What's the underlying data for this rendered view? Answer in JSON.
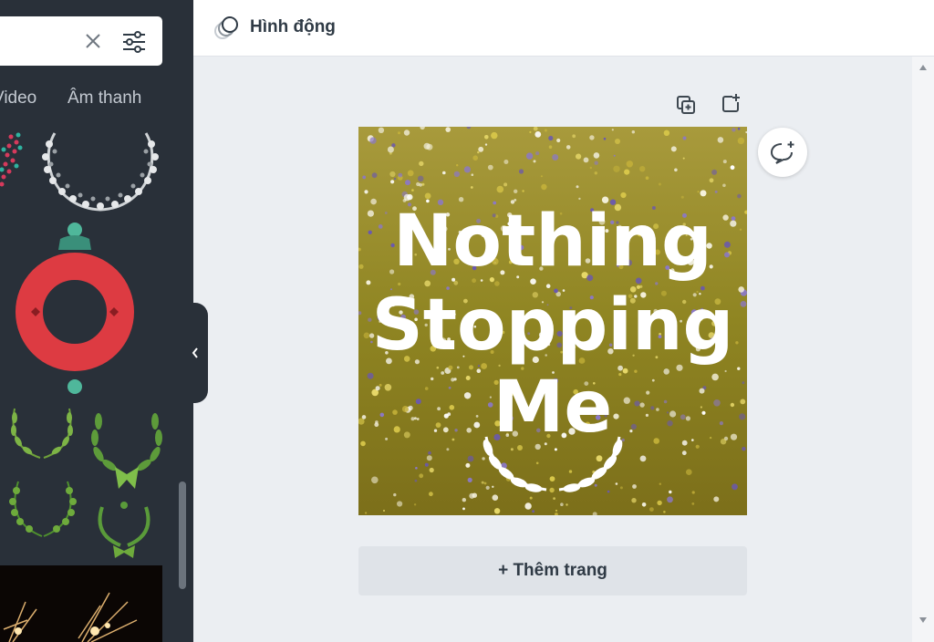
{
  "window": {
    "title": "Canva design editor"
  },
  "left_panel": {
    "tabs": [
      {
        "label": "Video"
      },
      {
        "label": "Âm thanh"
      }
    ],
    "assets": [
      {
        "icon": "heart-pattern-graphic"
      },
      {
        "icon": "silver-wreath-graphic"
      },
      {
        "icon": "red-ring-ornament-graphic"
      },
      {
        "icon": "laurel-wreath-graphic"
      },
      {
        "icon": "laurel-wreath-ribbon-graphic"
      },
      {
        "icon": "laurel-wreath-graphic"
      },
      {
        "icon": "laurel-wreath-ribbon-graphic"
      },
      {
        "icon": "sparkler-photo"
      }
    ]
  },
  "toolbar": {
    "animate_label": "Hình động"
  },
  "canvas": {
    "design_lines": [
      "Nothing",
      "Stopping",
      "Me"
    ],
    "add_page_label": "+ Thêm trang"
  },
  "colors": {
    "panel_bg": "#293039",
    "workspace_bg": "#ebeef2",
    "text_dark": "#2f3a45",
    "field_yellow": "#9a8a1e",
    "ornament_red": "#dd3b42",
    "ornament_teal": "#4fb79b",
    "laurel_green": "#5a9b3a"
  }
}
